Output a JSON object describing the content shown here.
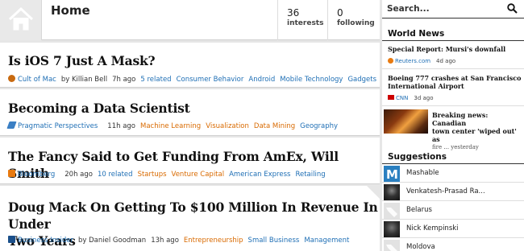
{
  "header": {
    "title": "Home",
    "interests_count": "36",
    "interests_label": "interests",
    "following_count": "0",
    "following_label": "following"
  },
  "feed": [
    {
      "title": "Is iOS 7 Just A Mask?",
      "source": "Cult of Mac",
      "by": "by Killian Bell",
      "time": "7h ago",
      "related": "5 related",
      "tags": [
        "Consumer Behavior",
        "Android",
        "Mobile Technology",
        "Gadgets"
      ]
    },
    {
      "title": "Becoming a Data Scientist",
      "source": "Pragmatic Perspectives",
      "time": "11h ago",
      "tags": [
        "Machine Learning",
        "Visualization",
        "Data Mining",
        "Geography"
      ]
    },
    {
      "title": "The Fancy Said to Get Funding From AmEx, Will Smith",
      "source": "Bloomberg",
      "time": "20h ago",
      "related": "10 related",
      "tags": [
        "Startups",
        "Venture Capital",
        "American Express",
        "Retailing"
      ]
    },
    {
      "title_line1": "Doug Mack On Getting To $100 Million In Revenue In Under",
      "title_line2": "Two Years",
      "source": "Business Insider",
      "by": "by Daniel Goodman",
      "time": "13h ago",
      "tags": [
        "Entrepreneurship",
        "Small Business",
        "Management"
      ]
    }
  ],
  "sidebar": {
    "search_placeholder": "Search...",
    "world_news_title": "World News",
    "news": [
      {
        "headline": "Special Report: Mursi's downfall",
        "source": "Reuters.com",
        "time": "4d ago"
      },
      {
        "headline_line1": "Boeing 777 crashes at San Francisco",
        "headline_line2": "International Airport",
        "source": "CNN",
        "time": "3d ago"
      },
      {
        "headline_line1": "Breaking news: Canadian",
        "headline_line2": "town center 'wiped out' as",
        "headline_line3": "fire ... yesterday"
      }
    ],
    "suggestions_title": "Suggestions",
    "suggestions": [
      "Mashable",
      "Venkatesh-Prasad Ra...",
      "Belarus",
      "Nick Kempinski",
      "Moldova"
    ]
  },
  "colors": {
    "link_blue": "#1f6fb5",
    "tag_orange": "#d96a00",
    "background": "#e6e6e6"
  }
}
